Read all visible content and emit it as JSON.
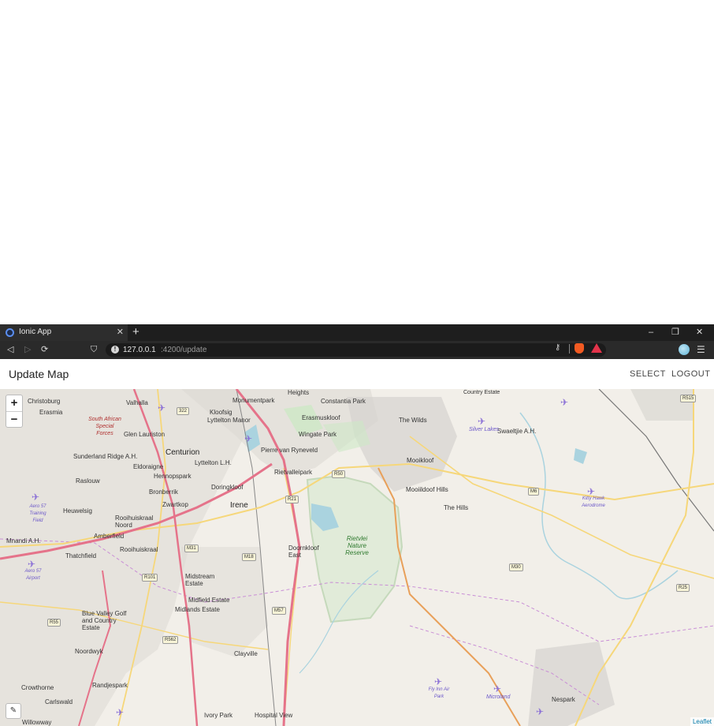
{
  "browser": {
    "tab": {
      "title": "Ionic App",
      "close": "✕"
    },
    "new_tab": "+",
    "window_controls": {
      "minimize": "–",
      "restore": "❐",
      "close": "✕"
    },
    "nav": {
      "back": "◁",
      "forward": "▷",
      "reload": "⟳",
      "bookmark": "⛉"
    },
    "url": {
      "host": "127.0.0.1",
      "path": ":4200/update",
      "info": "!"
    },
    "key_icon": "⚷",
    "menu": "☰"
  },
  "header": {
    "title": "Update Map",
    "select_label": "SELECT",
    "logout_label": "LOGOUT"
  },
  "map": {
    "zoom_in": "+",
    "zoom_out": "−",
    "edit": "✎",
    "attribution": "Leaflet",
    "places": [
      {
        "name": "Christoburg",
        "cls": ""
      },
      {
        "name": "Erasmia",
        "cls": ""
      },
      {
        "name": "Valhalla",
        "cls": ""
      },
      {
        "name": "Kloofsig",
        "cls": ""
      },
      {
        "name": "Monumentpark",
        "cls": ""
      },
      {
        "name": "Constantia Park",
        "cls": ""
      },
      {
        "name": "Erasmuskloof",
        "cls": ""
      },
      {
        "name": "The Wilds",
        "cls": ""
      },
      {
        "name": "Lyttelton Manor",
        "cls": ""
      },
      {
        "name": "Wingate Park",
        "cls": ""
      },
      {
        "name": "Glen Lauriston",
        "cls": ""
      },
      {
        "name": "Centurion",
        "cls": "big"
      },
      {
        "name": "Lyttelton L.H.",
        "cls": ""
      },
      {
        "name": "Pierre van Ryneveld",
        "cls": ""
      },
      {
        "name": "Rietvalleipark",
        "cls": ""
      },
      {
        "name": "Sunderland Ridge A.H.",
        "cls": ""
      },
      {
        "name": "Eldoraigne",
        "cls": ""
      },
      {
        "name": "Hennopspark",
        "cls": ""
      },
      {
        "name": "Raslouw",
        "cls": ""
      },
      {
        "name": "Bronberrik",
        "cls": ""
      },
      {
        "name": "Doringkloof",
        "cls": ""
      },
      {
        "name": "Zwartkop",
        "cls": ""
      },
      {
        "name": "Irene",
        "cls": "big"
      },
      {
        "name": "Heuwelsig",
        "cls": ""
      },
      {
        "name": "Rooihuiskraal Noord",
        "cls": ""
      },
      {
        "name": "Amberfield",
        "cls": ""
      },
      {
        "name": "Rooihuiskraal",
        "cls": ""
      },
      {
        "name": "Thatchfield",
        "cls": ""
      },
      {
        "name": "Mnandi A.H.",
        "cls": ""
      },
      {
        "name": "Doornkloof East",
        "cls": ""
      },
      {
        "name": "Midstream Estate",
        "cls": ""
      },
      {
        "name": "Midfield Estate",
        "cls": ""
      },
      {
        "name": "Midlands Estate",
        "cls": ""
      },
      {
        "name": "Blue Valley Golf and Country Estate",
        "cls": ""
      },
      {
        "name": "Noordwyk",
        "cls": ""
      },
      {
        "name": "Clayville",
        "cls": ""
      },
      {
        "name": "Crowthorne",
        "cls": ""
      },
      {
        "name": "Randjespark",
        "cls": ""
      },
      {
        "name": "Carlswald",
        "cls": ""
      },
      {
        "name": "Ivory Park",
        "cls": ""
      },
      {
        "name": "Hospital View",
        "cls": ""
      },
      {
        "name": "Willowway",
        "cls": ""
      },
      {
        "name": "Swaeltjie A.H.",
        "cls": ""
      },
      {
        "name": "Mooikloof",
        "cls": ""
      },
      {
        "name": "Mooiildoof Hills",
        "cls": ""
      },
      {
        "name": "The Hills",
        "cls": ""
      },
      {
        "name": "Nespark",
        "cls": ""
      },
      {
        "name": "Rietvlei Nature Reserve",
        "cls": "park"
      },
      {
        "name": "South African Special Forces",
        "cls": "red"
      },
      {
        "name": "Aero 57 Training Field",
        "cls": "blue"
      },
      {
        "name": "Aero 57 Airport",
        "cls": "blue"
      },
      {
        "name": "Silver Lakes",
        "cls": "blue"
      },
      {
        "name": "Kitty Hawk Aerodrome",
        "cls": "blue"
      },
      {
        "name": "Fly Inn Air Park",
        "cls": "blue"
      },
      {
        "name": "Microland",
        "cls": "blue"
      },
      {
        "name": "Heights",
        "cls": ""
      },
      {
        "name": "Country Estate",
        "cls": ""
      }
    ],
    "routes": [
      "R515",
      "M6",
      "M30",
      "R25",
      "R50",
      "R21",
      "M31",
      "M18",
      "R101",
      "M57",
      "R55",
      "R562",
      "322"
    ],
    "colors": {
      "land": "#f2efe9",
      "urban": "#dcd9d4",
      "water": "#aad3df",
      "park": "#cde8c6",
      "motorway": "#e5738a",
      "main_road": "#f6d77a",
      "boundary": "#c98ed6"
    }
  }
}
